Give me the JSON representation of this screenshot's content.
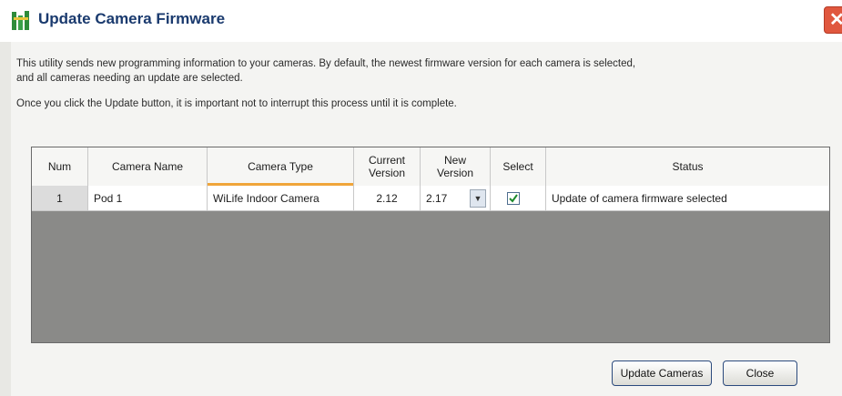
{
  "window": {
    "title": "Update Camera Firmware",
    "close_label": "✕"
  },
  "description": {
    "line1": "This utility sends new programming information to your cameras.  By default, the newest firmware version for each camera is selected,",
    "line2": "and all cameras needing an update are selected.",
    "line3": "Once you click the Update button, it is important not to interrupt this process until it is complete."
  },
  "table": {
    "columns": [
      "Num",
      "Camera Name",
      "Camera Type",
      "Current Version",
      "New Version",
      "Select",
      "Status"
    ],
    "rows": [
      {
        "num": "1",
        "camera_name": "Pod 1",
        "camera_type": "WiLife Indoor Camera",
        "current_version": "2.12",
        "new_version": "2.17",
        "selected": true,
        "status": "Update of camera firmware selected"
      }
    ]
  },
  "buttons": {
    "update": "Update Cameras",
    "close": "Close"
  },
  "colors": {
    "title": "#1a3a6e",
    "sort_indicator": "#f0a53a",
    "grid_empty": "#8a8a88"
  }
}
